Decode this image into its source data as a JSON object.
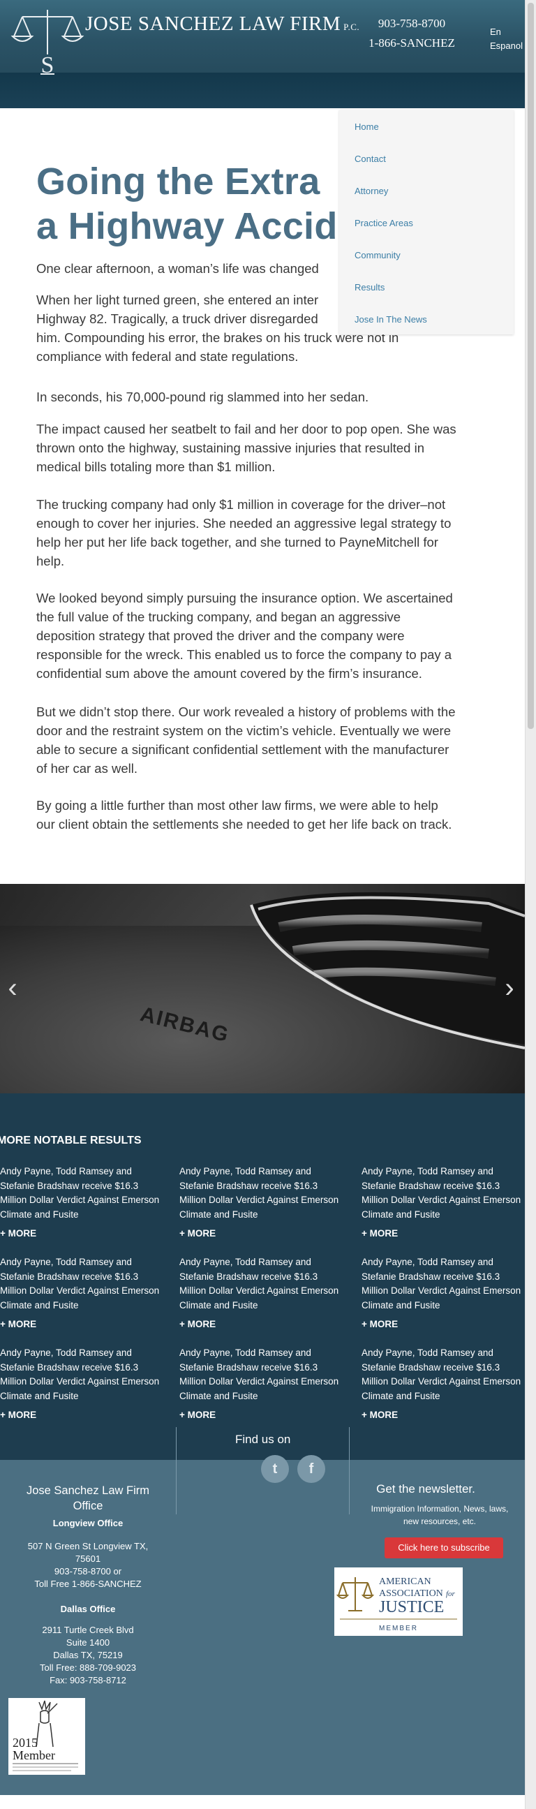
{
  "header": {
    "firm_name": "JOSE SANCHEZ LAW FIRM",
    "firm_suffix": "P.C.",
    "phone_1": "903-758-8700",
    "phone_2": "1-866-SANCHEZ",
    "lang_en": "En",
    "lang_es": "Espanol"
  },
  "nav": {
    "items": [
      "Home",
      "Contact",
      "Attorney",
      "Practice Areas",
      "Community",
      "Results",
      "Jose In The News"
    ]
  },
  "article": {
    "title_line1": "Going the Extra",
    "title_line2": "a Highway Accid",
    "p1": "One clear afternoon, a woman’s life was changed",
    "p2_l1": "When her light turned green, she entered an inter",
    "p2_l2": "Highway 82. Tragically, a truck driver disregarded",
    "p2_l3": "him. Compounding his error, the brakes on his truck were not in",
    "p2_l4": "compliance with federal and state regulations.",
    "p3": "In seconds, his 70,000-pound rig slammed into her sedan.",
    "p4_l1": "The impact caused her seatbelt to fail and her door to pop open. She was",
    "p4_l2": "thrown onto the highway, sustaining massive injuries that resulted in",
    "p4_l3": "medical bills totaling more than $1 million.",
    "p5_l1": "The trucking company had only $1 million in coverage for the driver–not",
    "p5_l2": "enough to cover her injuries. She needed an aggressive legal strategy to",
    "p5_l3": "help her put her life back together, and she turned to PayneMitchell for",
    "p5_l4": "help.",
    "p6_l1": "We looked beyond simply pursuing the insurance option. We ascertained",
    "p6_l2": "the full value of the trucking company, and began an aggressive",
    "p6_l3": "deposition strategy that proved the driver and the company were",
    "p6_l4": "responsible for the wreck. This enabled us to force the company to pay a",
    "p6_l5": "confidential sum above the amount covered by the firm’s insurance.",
    "p7_l1": "But we didn’t stop there. Our work revealed a history of problems with the",
    "p7_l2": "door and the restraint system on the victim’s vehicle. Eventually we were",
    "p7_l3": "able to secure a significant confidential settlement with the manufacturer",
    "p7_l4": "of her car as well.",
    "p8_l1": "By going a little further than most other law firms, we were able to help",
    "p8_l2": "our client obtain the settlements she needed to get her life back on track."
  },
  "slider": {
    "airbag_text": "AIRBAG",
    "prev_icon": "chevron-left-icon",
    "next_icon": "chevron-right-icon"
  },
  "results": {
    "heading": "MORE NOTABLE RESULTS",
    "item_l1": "Andy Payne, Todd Ramsey and",
    "item_l2": "Stefanie Bradshaw receive $16.3",
    "item_l3": "Million Dollar Verdict Against Emerson",
    "item_l4": "Climate and Fusite",
    "more_label": "+ MORE"
  },
  "footer": {
    "find_us": "Find us on",
    "twitter_glyph": "t",
    "facebook_glyph": "f",
    "office_title_l1": "Jose Sanchez Law Firm",
    "office_title_l2": "Office",
    "longview_heading": "Longview Office",
    "longview_l1": "507 N Green St Longview TX,",
    "longview_l2": "75601",
    "longview_l3": "903-758-8700 or",
    "longview_l4": "Toll Free 1-866-SANCHEZ",
    "dallas_heading": "Dallas Office",
    "dallas_l1": "2911 Turtle Creek Blvd",
    "dallas_l2": "Suite 1400",
    "dallas_l3": "Dallas TX, 75219",
    "dallas_l4": "Toll Free: 888-709-9023",
    "dallas_l5": "Fax: 903-758-8712",
    "newsletter_title": "Get the newsletter.",
    "newsletter_sub_l1": "Immigration Information, News, laws,",
    "newsletter_sub_l2": "new resources, etc.",
    "subscribe_label": "Click here to subscribe",
    "aaj_l1": "AMERICAN",
    "aaj_l2": "ASSOCIATION",
    "aaj_for": "for",
    "aaj_l3": "JUSTICE",
    "aaj_member": "MEMBER",
    "badge_year": "2015",
    "badge_member": "Member"
  }
}
